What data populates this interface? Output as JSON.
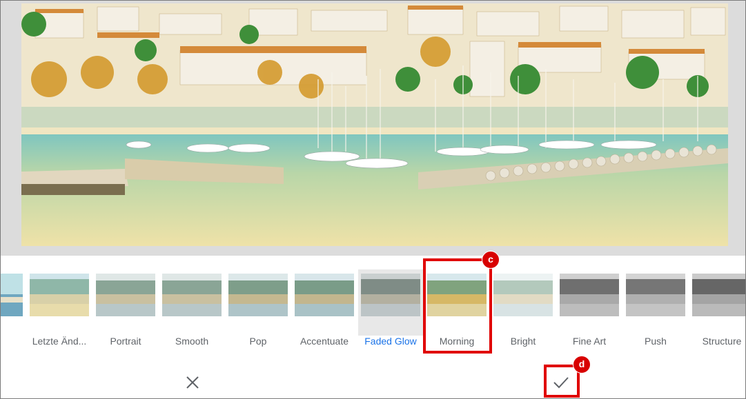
{
  "filters": [
    {
      "label": "",
      "style": "cool"
    },
    {
      "label": "Letzte Änd...",
      "style": "cool"
    },
    {
      "label": "Portrait",
      "style": "normal"
    },
    {
      "label": "Smooth",
      "style": "normal"
    },
    {
      "label": "Pop",
      "style": "normal"
    },
    {
      "label": "Accentuate",
      "style": "normal"
    },
    {
      "label": "Faded Glow",
      "style": "faded"
    },
    {
      "label": "Morning",
      "style": "warm"
    },
    {
      "label": "Bright",
      "style": "bright"
    },
    {
      "label": "Fine Art",
      "style": "mono"
    },
    {
      "label": "Push",
      "style": "mono"
    },
    {
      "label": "Structure",
      "style": "mono"
    }
  ],
  "active_filter": "Faded Glow",
  "markers": {
    "c": "c",
    "d": "d"
  },
  "actions": {
    "cancel_icon": "close-icon",
    "apply_icon": "check-icon"
  },
  "colors": {
    "accent": "#1a73e8",
    "highlight": "#e00000",
    "label": "#5f6368"
  }
}
